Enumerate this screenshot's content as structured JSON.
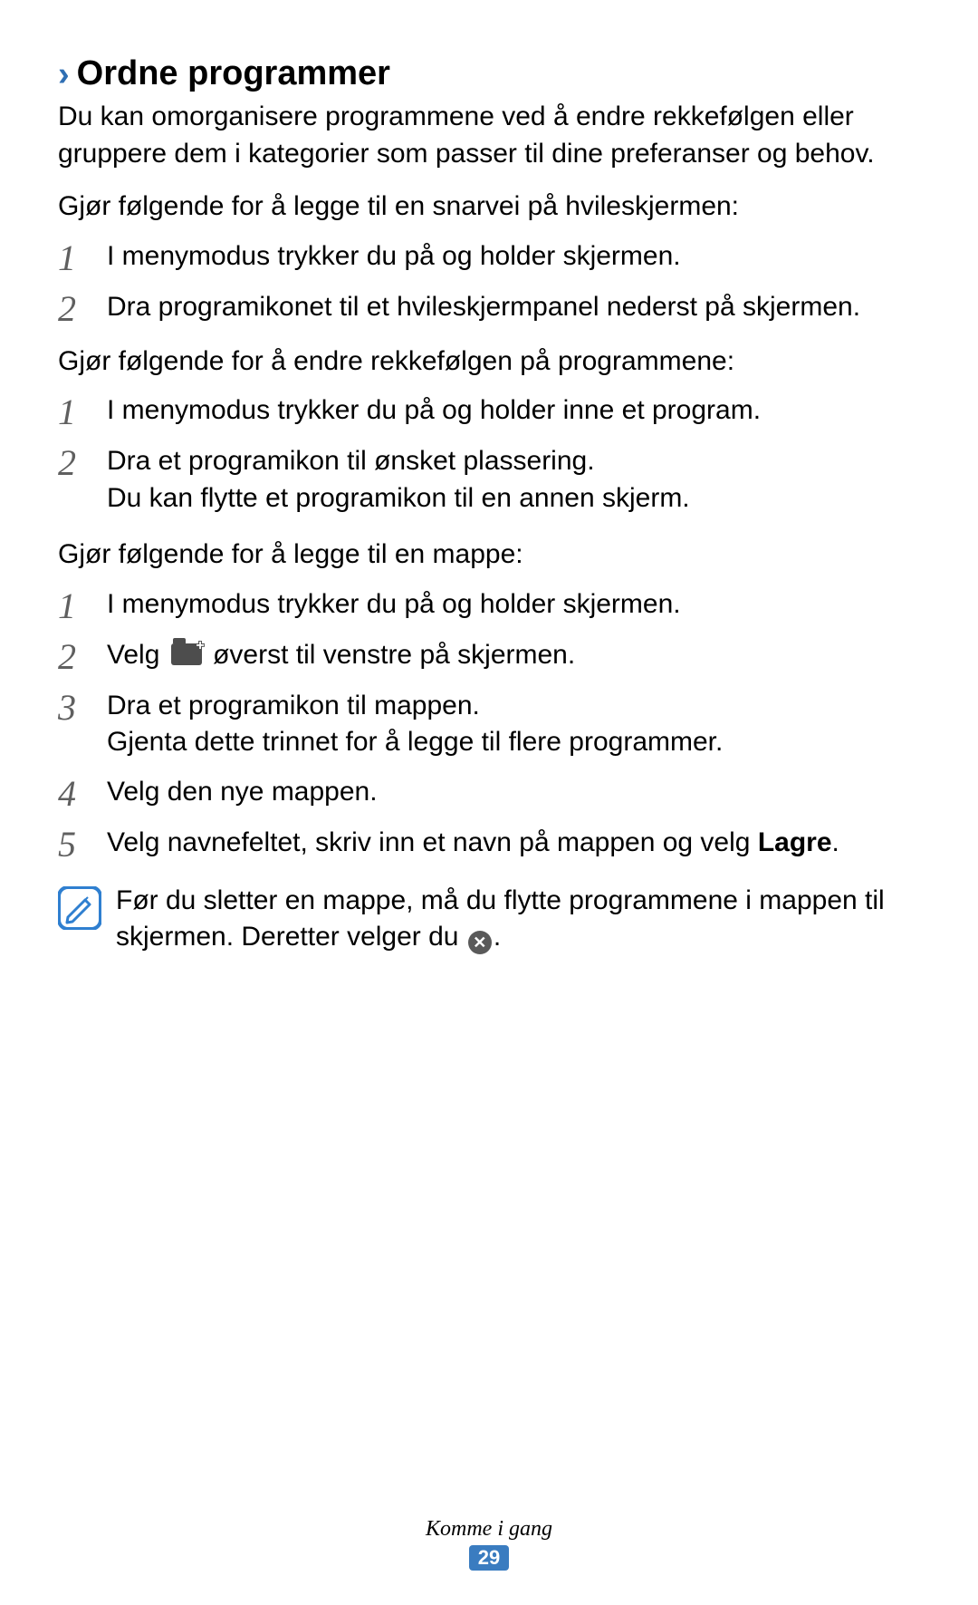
{
  "heading": {
    "chevron": "›",
    "title": "Ordne programmer"
  },
  "intro": "Du kan omorganisere programmene ved å endre rekkefølgen eller gruppere dem i kategorier som passer til dine preferanser og behov.",
  "section1": {
    "lead": "Gjør følgende for å legge til en snarvei på hvileskjermen:",
    "step1": "I menymodus trykker du på og holder skjermen.",
    "step2": "Dra programikonet til et hvileskjermpanel nederst på skjermen."
  },
  "section2": {
    "lead": "Gjør følgende for å endre rekkefølgen på programmene:",
    "step1": "I menymodus trykker du på og holder inne et program.",
    "step2a": "Dra et programikon til ønsket plassering.",
    "step2b": "Du kan flytte et programikon til en annen skjerm."
  },
  "section3": {
    "lead": "Gjør følgende for å legge til en mappe:",
    "step1": "I menymodus trykker du på og holder skjermen.",
    "step2a": "Velg ",
    "step2b": " øverst til venstre på skjermen.",
    "step3a": "Dra et programikon til mappen.",
    "step3b": "Gjenta dette trinnet for å legge til flere programmer.",
    "step4": "Velg den nye mappen.",
    "step5a": "Velg navnefeltet, skriv inn et navn på mappen og velg ",
    "step5b": "Lagre",
    "step5c": "."
  },
  "note": {
    "text_a": "Før du sletter en mappe, må du flytte programmene i mappen til skjermen. Deretter velger du ",
    "text_b": "."
  },
  "footer": {
    "chapter": "Komme i gang",
    "page": "29"
  },
  "nums": {
    "n1": "1",
    "n2": "2",
    "n3": "3",
    "n4": "4",
    "n5": "5"
  }
}
